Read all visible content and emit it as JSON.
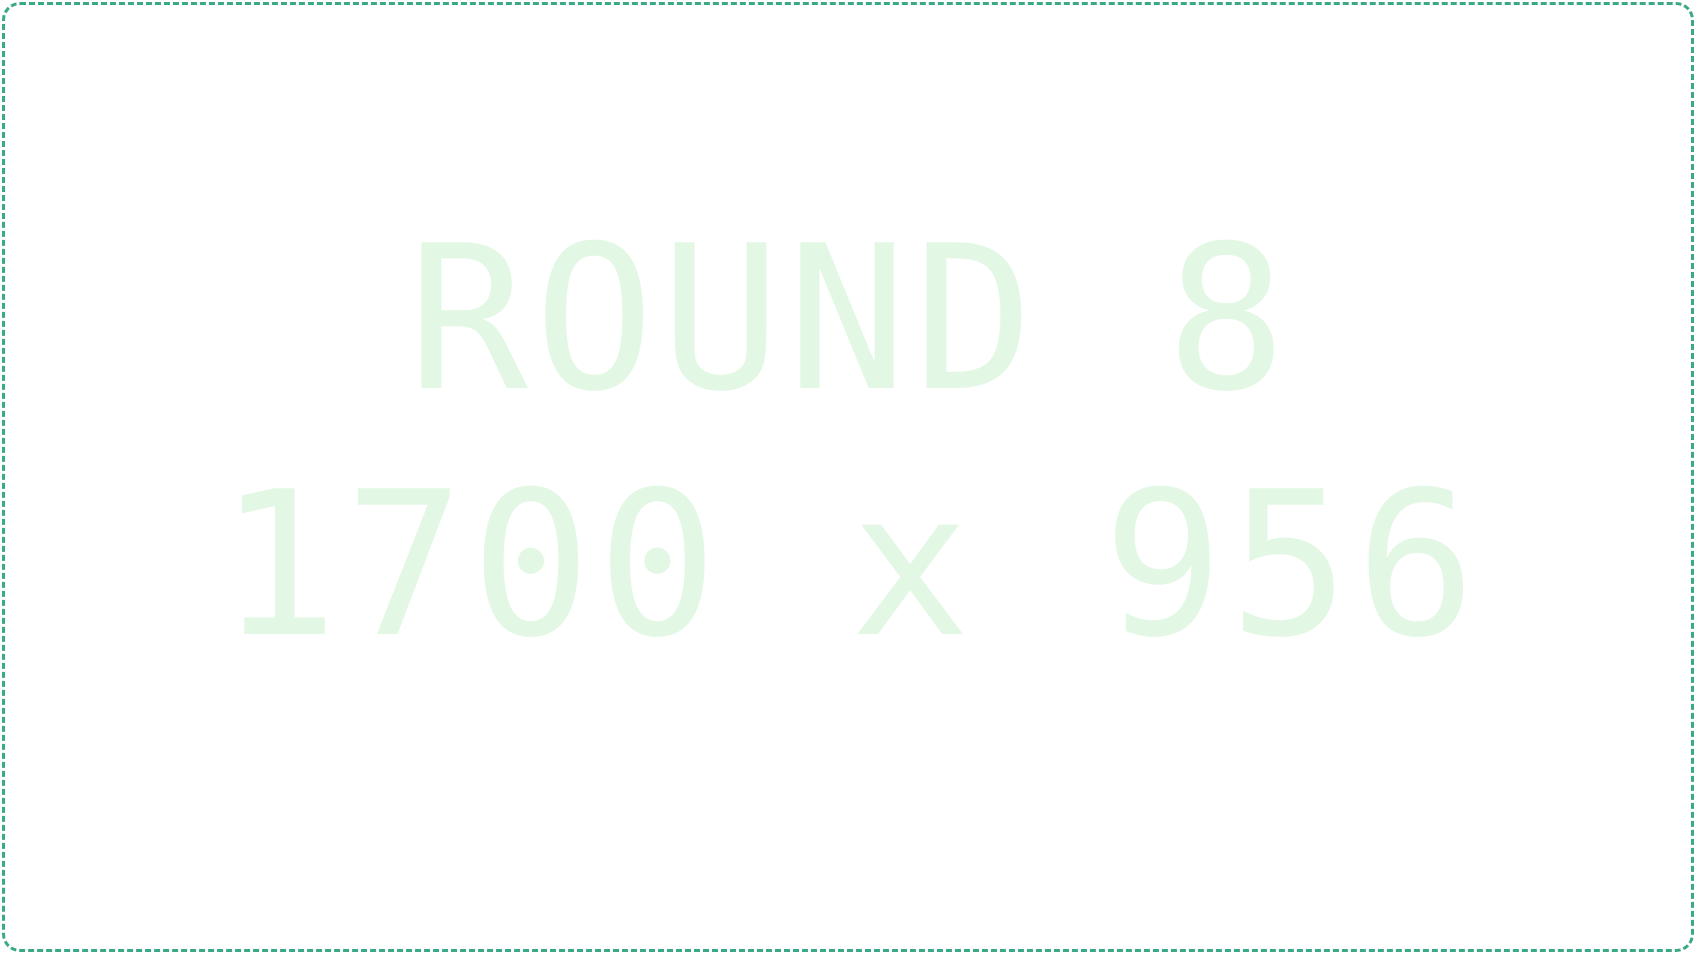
{
  "placeholder": {
    "round_label": "ROUND 8",
    "dimensions_label": "1700 x 956",
    "text_color": "#e2f7e4",
    "border_color": "#3aa987",
    "background_color": "#ffffff"
  }
}
